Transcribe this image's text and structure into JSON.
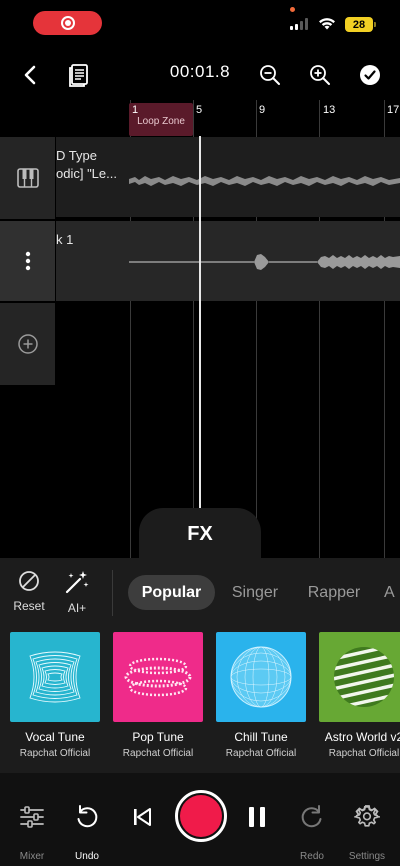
{
  "status_bar": {
    "battery": "28",
    "recording_color": "#e5343a"
  },
  "toolbar": {
    "time": "00:01.8",
    "icons": [
      "back-chevron-icon",
      "lyrics-notes-icon",
      "zoom-out-icon",
      "zoom-in-icon",
      "done-check-icon"
    ]
  },
  "timeline": {
    "loop_zone_label": "Loop Zone",
    "ruler_ticks": [
      "1",
      "5",
      "9",
      "13",
      "17"
    ],
    "tracks": [
      {
        "name_line1": "D Type",
        "name_line2": "odic] \"Le..."
      },
      {
        "name_line1": "k 1",
        "name_line2": ""
      }
    ]
  },
  "fx": {
    "tab_label": "FX",
    "tools": [
      {
        "label": "Reset",
        "icon": "reset-circle-slash-icon"
      },
      {
        "label": "AI+",
        "icon": "magic-wand-icon"
      }
    ],
    "categories": [
      "Popular",
      "Singer",
      "Rapper",
      "A"
    ],
    "active_category": "Popular",
    "presets": [
      {
        "title": "Vocal Tune",
        "author": "Rapchat Official",
        "color": "#27b5cf"
      },
      {
        "title": "Pop Tune",
        "author": "Rapchat Official",
        "color": "#ef2b8a"
      },
      {
        "title": "Chill Tune",
        "author": "Rapchat Official",
        "color": "#2ab3ec"
      },
      {
        "title": "Astro World v2",
        "author": "Rapchat Official",
        "color": "#67a834"
      }
    ]
  },
  "bottom_bar": {
    "mixer_label": "Mixer",
    "undo_label": "Undo",
    "redo_label": "Redo",
    "settings_label": "Settings",
    "record_color": "#f01b4a"
  }
}
